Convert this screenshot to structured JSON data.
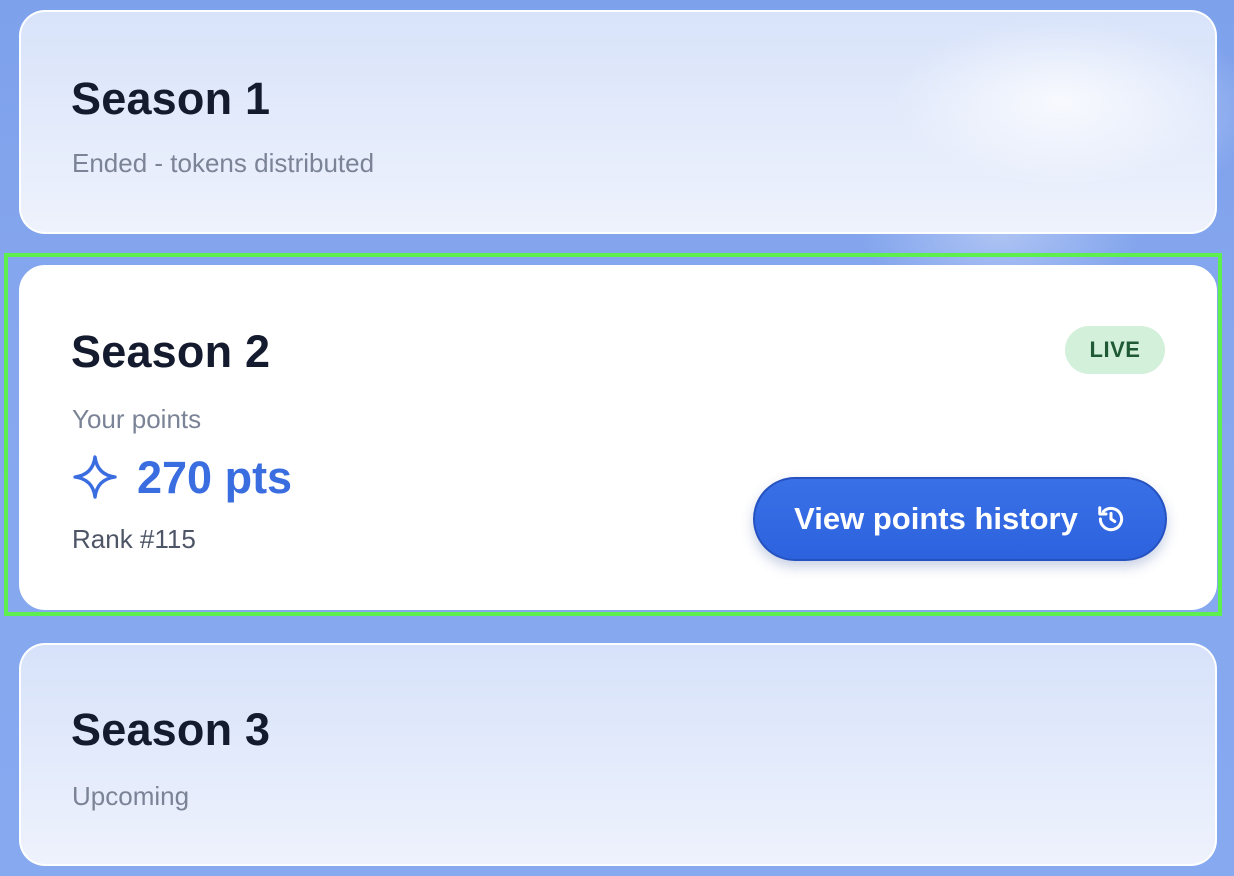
{
  "seasons": [
    {
      "title": "Season 1",
      "status": "Ended - tokens distributed"
    },
    {
      "title": "Season 2",
      "badge": "LIVE",
      "points_label": "Your points",
      "points_value": "270 pts",
      "rank": "Rank #115",
      "button_label": "View points history"
    },
    {
      "title": "Season 3",
      "status": "Upcoming"
    }
  ],
  "icons": {
    "points": "sparkle-icon",
    "history": "history-icon"
  },
  "colors": {
    "accent": "#3a6de0",
    "button": "#2c62de",
    "live_badge_bg": "#d3f0da",
    "live_badge_text": "#1f5a35",
    "selection_outline": "#5cef4d"
  }
}
